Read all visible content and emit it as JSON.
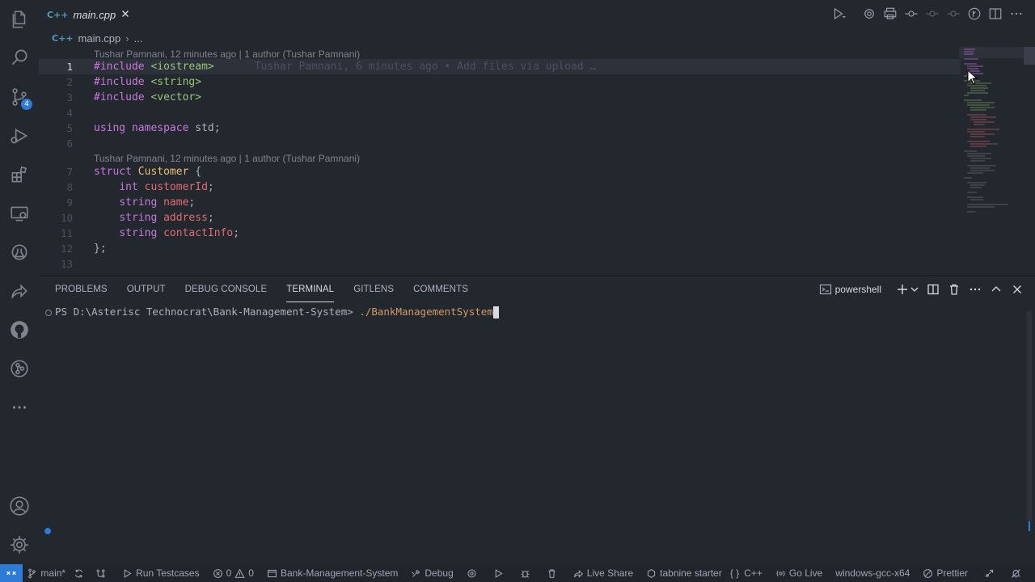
{
  "tab": {
    "label": "main.cpp",
    "glyph": "C++"
  },
  "breadcrumb": {
    "file": "main.cpp",
    "more": "..."
  },
  "editor": {
    "codelens": [
      "Tushar Pamnani, 12 minutes ago | 1 author (Tushar Pamnani)",
      "Tushar Pamnani, 12 minutes ago | 1 author (Tushar Pamnani)"
    ],
    "blame": "Tushar Pamnani, 6 minutes ago • Add files via upload …",
    "line_numbers": [
      "1",
      "2",
      "3",
      "4",
      "5",
      "6",
      "7",
      "8",
      "9",
      "10",
      "11",
      "12",
      "13"
    ],
    "lines": {
      "l1_kw": "#include",
      "l1_str": "<iostream>",
      "l2_kw": "#include",
      "l2_str": "<string>",
      "l3_kw": "#include",
      "l3_str": "<vector>",
      "l5_kw1": "using",
      "l5_kw2": "namespace",
      "l5_pl": "std;",
      "l7_kw": "struct",
      "l7_typ": "Customer",
      "l7_pl": "{",
      "l8_kw": "int",
      "l8_var": "customerId",
      "l8_pl": ";",
      "l9_kw": "string",
      "l9_var": "name",
      "l9_pl": ";",
      "l10_kw": "string",
      "l10_var": "address",
      "l10_pl": ";",
      "l11_kw": "string",
      "l11_var": "contactInfo",
      "l11_pl": ";",
      "l12_pl": "};"
    }
  },
  "panel": {
    "tabs": [
      "PROBLEMS",
      "OUTPUT",
      "DEBUG CONSOLE",
      "TERMINAL",
      "GITLENS",
      "COMMENTS"
    ],
    "active_tab": "TERMINAL",
    "shell": "powershell"
  },
  "terminal": {
    "prompt": "PS D:\\Asterisc Technocrat\\Bank-Management-System> ",
    "command": "./BankManagementSystem"
  },
  "activity": {
    "icons": [
      "files-icon",
      "search-icon",
      "source-control-icon",
      "run-debug-icon",
      "extensions-icon",
      "remote-explorer-icon",
      "testing-icon",
      "live-share-icon",
      "github-icon",
      "gitlens-icon",
      "more-icon",
      "account-icon",
      "manage-gear-icon"
    ],
    "source_control_badge": "4"
  },
  "statusbar": {
    "branch": "main*",
    "run_testcases": "Run Testcases",
    "errors": "0",
    "warnings": "0",
    "folder": "Bank-Management-System",
    "debug": "Debug",
    "live_share": "Live Share",
    "tabnine": "tabnine starter",
    "language": "C++",
    "go_live": "Go Live",
    "config": "windows-gcc-x64",
    "prettier": "Prettier"
  },
  "colors": {
    "background": "#23272e",
    "accent": "#2d7bd6",
    "keyword": "#c678dd",
    "string": "#98c379",
    "type": "#e5c07b",
    "variable": "#e06c75",
    "command": "#d19a66"
  }
}
